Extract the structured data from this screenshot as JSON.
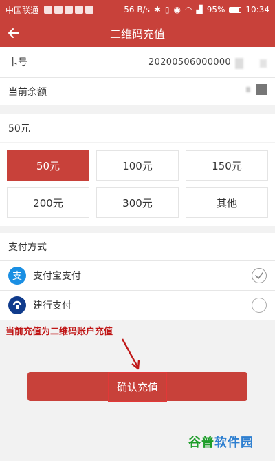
{
  "status_bar": {
    "carrier": "中国联通",
    "network_speed": "56 B/s",
    "battery": "95%",
    "time": "10:34"
  },
  "app_bar": {
    "title": "二维码充值",
    "back_icon": "arrow-left-icon"
  },
  "card": {
    "label": "卡号",
    "number": "20200506000000"
  },
  "balance": {
    "label": "当前余额"
  },
  "amount_input": {
    "value": "50元"
  },
  "amount_options": [
    {
      "label": "50元",
      "selected": true
    },
    {
      "label": "100元",
      "selected": false
    },
    {
      "label": "150元",
      "selected": false
    },
    {
      "label": "200元",
      "selected": false
    },
    {
      "label": "300元",
      "selected": false
    },
    {
      "label": "其他",
      "selected": false
    }
  ],
  "payment": {
    "section_label": "支付方式",
    "methods": [
      {
        "label": "支付宝支付",
        "icon": "alipay-icon",
        "selected": true
      },
      {
        "label": "建行支付",
        "icon": "ccb-icon",
        "selected": false
      }
    ]
  },
  "annotation": "当前充值为二维码账户充值",
  "confirm_label": "确认充值",
  "watermark": {
    "part1": "谷普",
    "part2": "软件园"
  },
  "colors": {
    "brand": "#c8413a",
    "annotation": "#c01818",
    "alipay": "#1a8fe3",
    "ccb": "#103b8c"
  }
}
